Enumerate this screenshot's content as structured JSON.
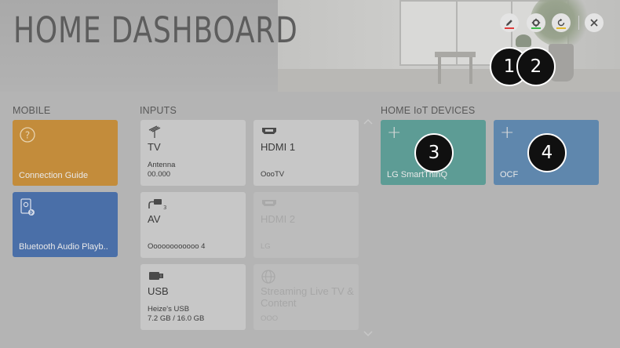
{
  "header": {
    "title": "HOME DASHBOARD",
    "buttons": [
      {
        "name": "edit",
        "icon": "pencil-icon",
        "color": "#e03c3c"
      },
      {
        "name": "settings",
        "icon": "gear-icon",
        "color": "#3dbb4a"
      },
      {
        "name": "refresh",
        "icon": "refresh-icon",
        "color": "#e0b92c"
      },
      {
        "name": "close",
        "icon": "close-icon"
      }
    ]
  },
  "callouts": [
    "1",
    "2",
    "3",
    "4"
  ],
  "sections": {
    "mobile": "MOBILE",
    "inputs": "INPUTS",
    "iot": "HOME IoT DEVICES"
  },
  "mobile": [
    {
      "label": "Connection Guide",
      "icon": "question-icon",
      "color": "#c38c3b"
    },
    {
      "label": "Bluetooth Audio Playb..",
      "icon": "bluetooth-speaker-icon",
      "color": "#4a6fa8"
    }
  ],
  "inputs": [
    {
      "name": "TV",
      "sub1": "Antenna",
      "sub2": "00.000",
      "icon": "antenna-icon",
      "state": "active"
    },
    {
      "name": "HDMI 1",
      "sub1": "",
      "sub2": "OooTV",
      "icon": "hdmi-icon",
      "state": "active"
    },
    {
      "name": "AV",
      "sub1": "",
      "sub2": "Oooooooooooo 4",
      "icon": "av-cable-icon",
      "state": "active"
    },
    {
      "name": "HDMI 2",
      "sub1": "",
      "sub2": "LG",
      "icon": "hdmi-icon",
      "state": "dim"
    },
    {
      "name": "USB",
      "sub1": "Heize's USB",
      "sub2": "7.2 GB / 16.0 GB",
      "icon": "usb-icon",
      "state": "active"
    },
    {
      "name": "Streaming Live TV & Content",
      "sub1": "",
      "sub2": "OOO",
      "icon": "globe-icon",
      "state": "dim"
    }
  ],
  "iot": [
    {
      "label": "LG SmartThinQ",
      "icon": "plus-icon",
      "color": "#5d9c95"
    },
    {
      "label": "OCF",
      "icon": "plus-icon",
      "color": "#5f87ad"
    }
  ]
}
